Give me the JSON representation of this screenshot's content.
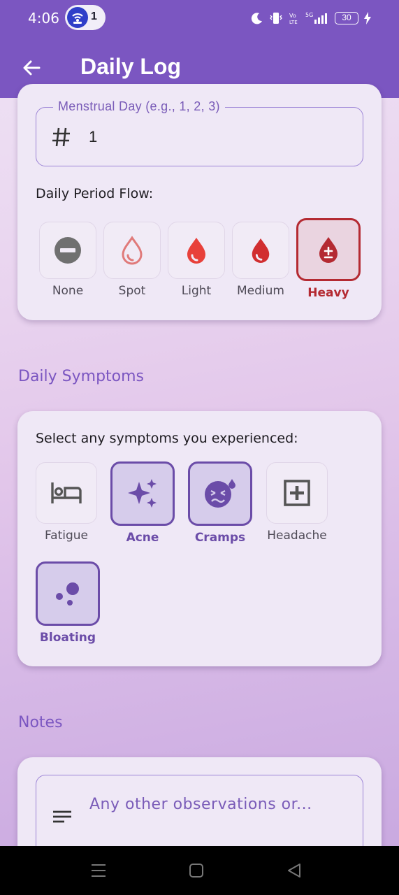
{
  "status": {
    "time": "4:06",
    "hotspot_count": "1",
    "battery": "30"
  },
  "appbar": {
    "title": "Daily Log"
  },
  "menstrual_day": {
    "label": "Menstrual Day (e.g., 1, 2, 3)",
    "value": "1"
  },
  "flow": {
    "label": "Daily Period Flow:",
    "options": [
      {
        "label": "None",
        "icon": "remove-circle-icon",
        "selected": false
      },
      {
        "label": "Spot",
        "icon": "drop-outline-icon",
        "selected": false
      },
      {
        "label": "Light",
        "icon": "drop-icon",
        "selected": false
      },
      {
        "label": "Medium",
        "icon": "drop-icon",
        "selected": false
      },
      {
        "label": "Heavy",
        "icon": "drop-plus-minus-icon",
        "selected": true
      }
    ]
  },
  "symptoms": {
    "section_title": "Daily Symptoms",
    "prompt": "Select any symptoms you experienced:",
    "options": [
      {
        "label": "Fatigue",
        "icon": "bed-icon",
        "selected": false
      },
      {
        "label": "Acne",
        "icon": "sparkles-icon",
        "selected": true
      },
      {
        "label": "Cramps",
        "icon": "sick-face-icon",
        "selected": true
      },
      {
        "label": "Headache",
        "icon": "medical-plus-icon",
        "selected": false
      },
      {
        "label": "Bloating",
        "icon": "bubbles-icon",
        "selected": true
      }
    ]
  },
  "notes": {
    "section_title": "Notes",
    "placeholder": "Any other observations or..."
  },
  "colors": {
    "primary": "#7b56c1",
    "heavy": "#b42a32",
    "selected_border": "#6b4ca8",
    "light_drop": "#e8403a",
    "medium_drop": "#d12e30",
    "spot_drop": "#e07a7a"
  }
}
